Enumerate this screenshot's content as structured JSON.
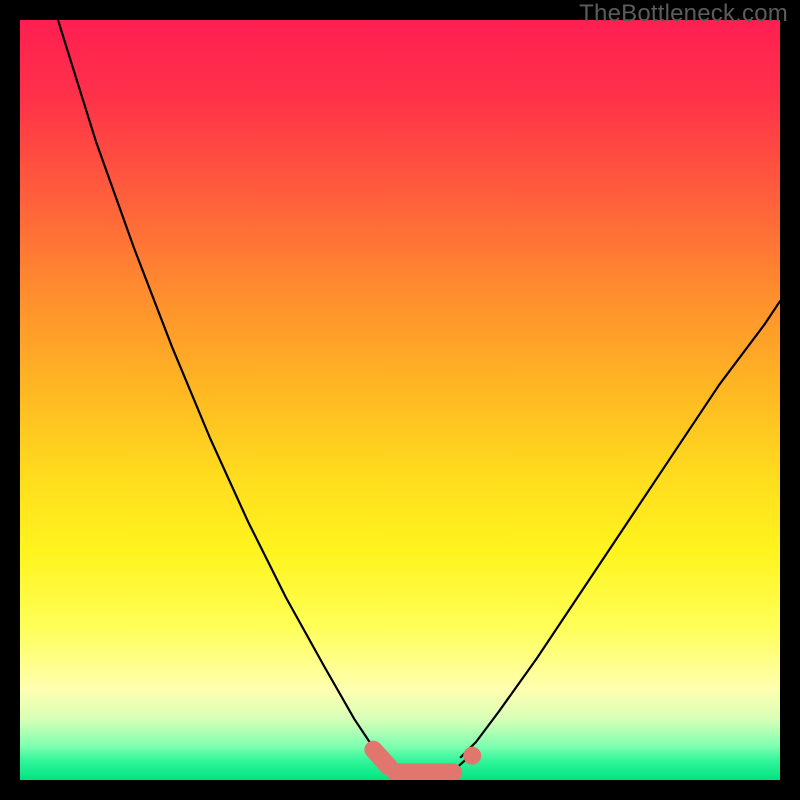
{
  "watermark": "TheBottleneck.com",
  "colors": {
    "black": "#000000",
    "curve": "#000000",
    "marker": "#e0766e",
    "gradient_stops": [
      {
        "offset": 0.0,
        "color": "#ff1f52"
      },
      {
        "offset": 0.1,
        "color": "#ff3149"
      },
      {
        "offset": 0.22,
        "color": "#ff5a3d"
      },
      {
        "offset": 0.35,
        "color": "#ff8a2f"
      },
      {
        "offset": 0.48,
        "color": "#ffb523"
      },
      {
        "offset": 0.6,
        "color": "#ffdc1e"
      },
      {
        "offset": 0.7,
        "color": "#fff41e"
      },
      {
        "offset": 0.8,
        "color": "#ffff59"
      },
      {
        "offset": 0.88,
        "color": "#ffffb0"
      },
      {
        "offset": 0.92,
        "color": "#d8ffb8"
      },
      {
        "offset": 0.955,
        "color": "#7fffb0"
      },
      {
        "offset": 0.975,
        "color": "#30f59a"
      },
      {
        "offset": 1.0,
        "color": "#00e37e"
      }
    ]
  },
  "chart_data": {
    "type": "line",
    "title": "",
    "xlabel": "",
    "ylabel": "",
    "xlim": [
      0,
      100
    ],
    "ylim": [
      0,
      100
    ],
    "series": [
      {
        "name": "left-branch",
        "x": [
          5,
          10,
          15,
          20,
          25,
          30,
          35,
          40,
          44,
          46,
          48
        ],
        "y": [
          100,
          84,
          70,
          57,
          45,
          34,
          24,
          15,
          8,
          5,
          3
        ]
      },
      {
        "name": "right-branch",
        "x": [
          58,
          60,
          63,
          68,
          74,
          80,
          86,
          92,
          98,
          100
        ],
        "y": [
          3,
          5,
          9,
          16,
          25,
          34,
          43,
          52,
          60,
          63
        ]
      },
      {
        "name": "valley-floor",
        "x": [
          47,
          49,
          51,
          53,
          55,
          57,
          59
        ],
        "y": [
          3,
          1.2,
          0.8,
          0.8,
          0.8,
          1.2,
          3
        ]
      }
    ],
    "markers": [
      {
        "name": "left-pill-start",
        "x": 46.5,
        "y": 4.0
      },
      {
        "name": "left-pill-end",
        "x": 48.5,
        "y": 1.8
      },
      {
        "name": "floor-pill-start",
        "x": 49.5,
        "y": 1.0
      },
      {
        "name": "floor-pill-end",
        "x": 57.0,
        "y": 1.0
      },
      {
        "name": "right-dot",
        "x": 59.5,
        "y": 3.2
      }
    ]
  }
}
